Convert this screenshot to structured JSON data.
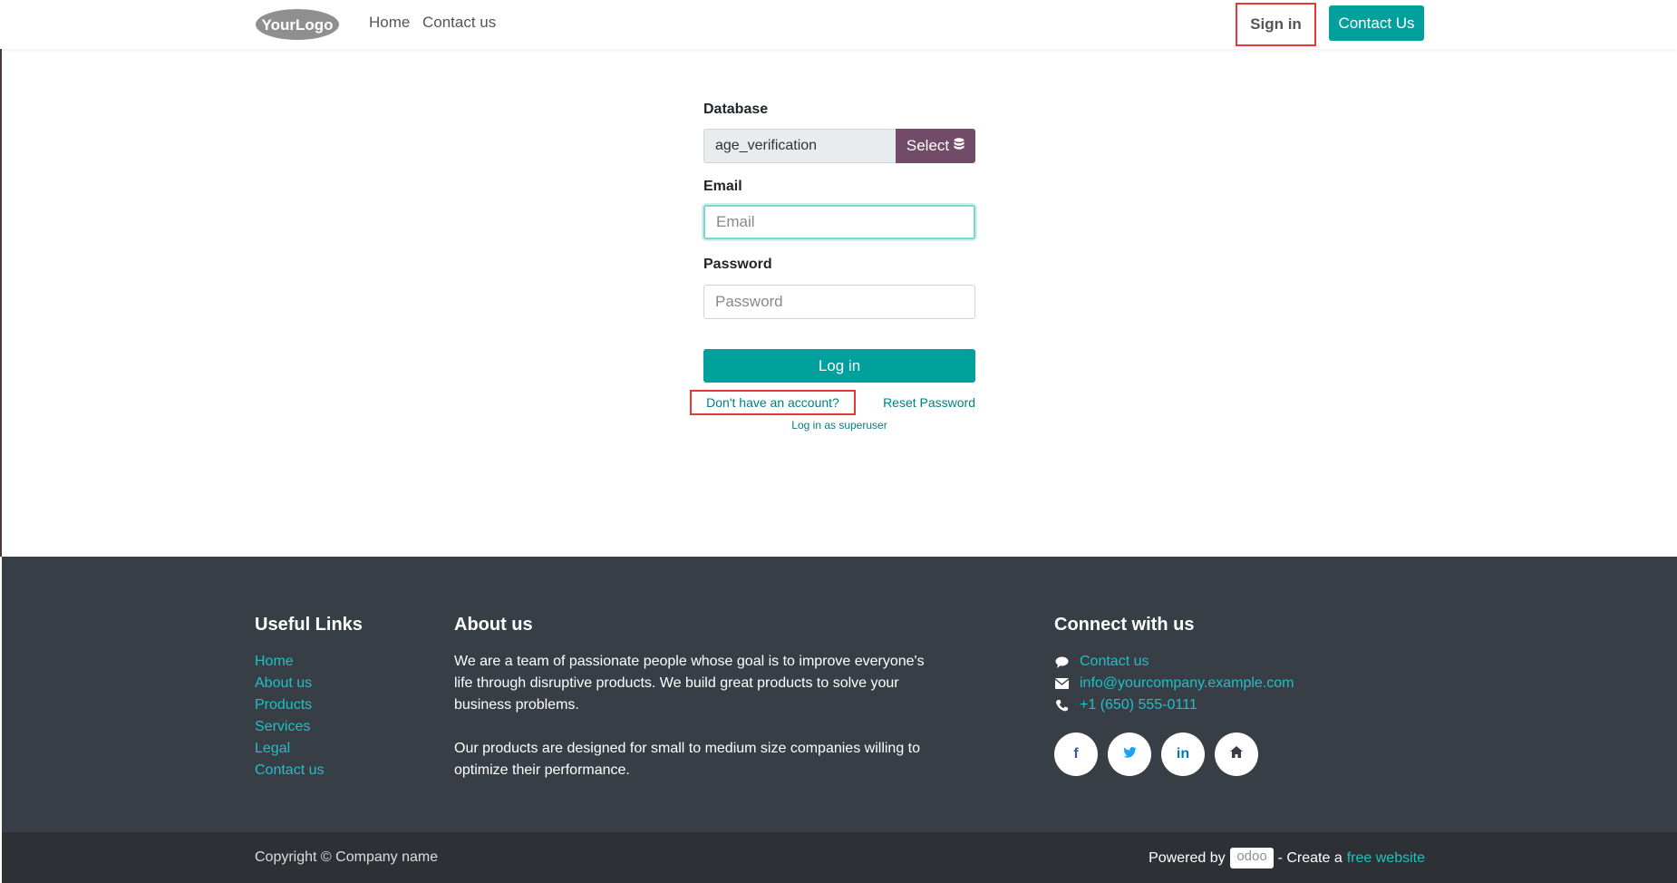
{
  "header": {
    "logo_text": "YourLogo",
    "nav": {
      "home": "Home",
      "contact": "Contact us"
    },
    "sign_in": "Sign in",
    "contact_button": "Contact Us"
  },
  "login_form": {
    "database_label": "Database",
    "database_value": "age_verification",
    "select_label": "Select",
    "email_label": "Email",
    "email_placeholder": "Email",
    "password_label": "Password",
    "password_placeholder": "Password",
    "login_button": "Log in",
    "signup_link": "Don't have an account?",
    "reset_link": "Reset Password",
    "superuser_link": "Log in as superuser"
  },
  "footer": {
    "useful_links_title": "Useful Links",
    "useful_links": [
      "Home",
      "About us",
      "Products",
      "Services",
      "Legal",
      "Contact us"
    ],
    "about_title": "About us",
    "about_p1": "We are a team of passionate people whose goal is to improve everyone's life through disruptive products. We build great products to solve your business problems.",
    "about_p2": "Our products are designed for small to medium size companies willing to optimize their performance.",
    "connect_title": "Connect with us",
    "contact_link": "Contact us",
    "email": "info@yourcompany.example.com",
    "phone": "+1 (650) 555-0111",
    "social": [
      "facebook-icon",
      "twitter-icon",
      "linkedin-icon",
      "home-icon"
    ]
  },
  "bottom_bar": {
    "copyright": "Copyright © Company name",
    "powered_by": "Powered by",
    "odoo": "odoo",
    "create_a": "- Create a",
    "free_website": "free website"
  },
  "colors": {
    "primary": "#00a09d",
    "select_button": "#714b67",
    "footer_bg": "#383e45",
    "bottom_bg": "#2d3136",
    "link": "#017e84",
    "footer_link": "#1fc0c4",
    "highlight_box": "#e53935"
  }
}
